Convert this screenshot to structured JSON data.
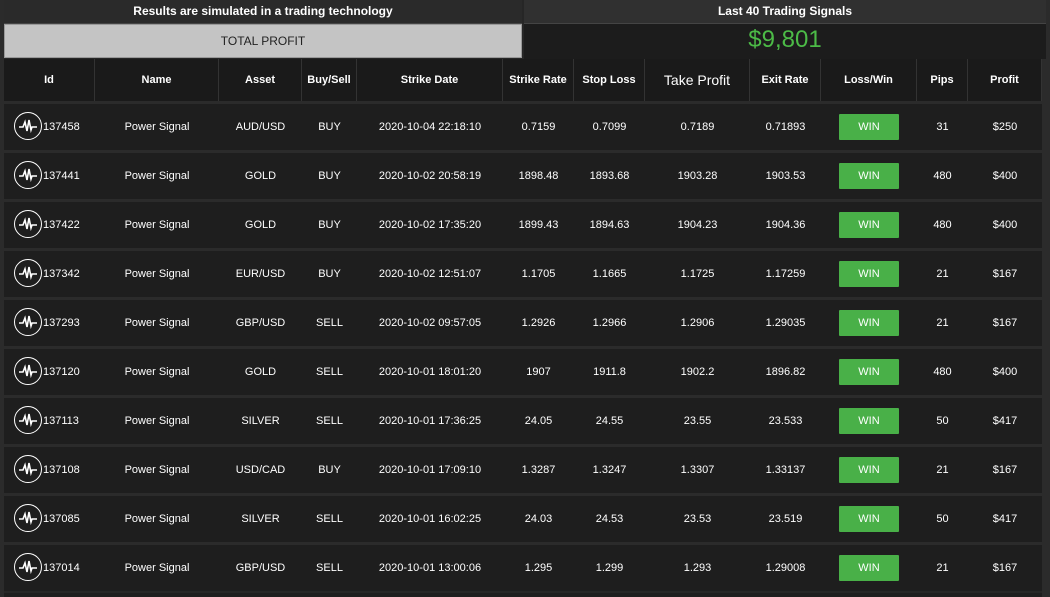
{
  "header": {
    "left_title": "Results are simulated in a trading technology",
    "total_profit_label": "TOTAL PROFIT",
    "right_title": "Last 40 Trading Signals",
    "total_profit_value": "$9,801"
  },
  "columns": [
    "Id",
    "Name",
    "Asset",
    "Buy/Sell",
    "Strike Date",
    "Strike Rate",
    "Stop Loss",
    "Take Profit",
    "Exit Rate",
    "Loss/Win",
    "Pips",
    "Profit"
  ],
  "rows": [
    {
      "id": "137458",
      "name": "Power Signal",
      "asset": "AUD/USD",
      "side": "BUY",
      "date": "2020-10-04 22:18:10",
      "strike": "0.7159",
      "stop": "0.7099",
      "take": "0.7189",
      "exit": "0.71893",
      "result": "WIN",
      "pips": "31",
      "profit": "$250"
    },
    {
      "id": "137441",
      "name": "Power Signal",
      "asset": "GOLD",
      "side": "BUY",
      "date": "2020-10-02 20:58:19",
      "strike": "1898.48",
      "stop": "1893.68",
      "take": "1903.28",
      "exit": "1903.53",
      "result": "WIN",
      "pips": "480",
      "profit": "$400"
    },
    {
      "id": "137422",
      "name": "Power Signal",
      "asset": "GOLD",
      "side": "BUY",
      "date": "2020-10-02 17:35:20",
      "strike": "1899.43",
      "stop": "1894.63",
      "take": "1904.23",
      "exit": "1904.36",
      "result": "WIN",
      "pips": "480",
      "profit": "$400"
    },
    {
      "id": "137342",
      "name": "Power Signal",
      "asset": "EUR/USD",
      "side": "BUY",
      "date": "2020-10-02 12:51:07",
      "strike": "1.1705",
      "stop": "1.1665",
      "take": "1.1725",
      "exit": "1.17259",
      "result": "WIN",
      "pips": "21",
      "profit": "$167"
    },
    {
      "id": "137293",
      "name": "Power Signal",
      "asset": "GBP/USD",
      "side": "SELL",
      "date": "2020-10-02 09:57:05",
      "strike": "1.2926",
      "stop": "1.2966",
      "take": "1.2906",
      "exit": "1.29035",
      "result": "WIN",
      "pips": "21",
      "profit": "$167"
    },
    {
      "id": "137120",
      "name": "Power Signal",
      "asset": "GOLD",
      "side": "SELL",
      "date": "2020-10-01 18:01:20",
      "strike": "1907",
      "stop": "1911.8",
      "take": "1902.2",
      "exit": "1896.82",
      "result": "WIN",
      "pips": "480",
      "profit": "$400"
    },
    {
      "id": "137113",
      "name": "Power Signal",
      "asset": "SILVER",
      "side": "SELL",
      "date": "2020-10-01 17:36:25",
      "strike": "24.05",
      "stop": "24.55",
      "take": "23.55",
      "exit": "23.533",
      "result": "WIN",
      "pips": "50",
      "profit": "$417"
    },
    {
      "id": "137108",
      "name": "Power Signal",
      "asset": "USD/CAD",
      "side": "BUY",
      "date": "2020-10-01 17:09:10",
      "strike": "1.3287",
      "stop": "1.3247",
      "take": "1.3307",
      "exit": "1.33137",
      "result": "WIN",
      "pips": "21",
      "profit": "$167"
    },
    {
      "id": "137085",
      "name": "Power Signal",
      "asset": "SILVER",
      "side": "SELL",
      "date": "2020-10-01 16:02:25",
      "strike": "24.03",
      "stop": "24.53",
      "take": "23.53",
      "exit": "23.519",
      "result": "WIN",
      "pips": "50",
      "profit": "$417"
    },
    {
      "id": "137014",
      "name": "Power Signal",
      "asset": "GBP/USD",
      "side": "SELL",
      "date": "2020-10-01 13:00:06",
      "strike": "1.295",
      "stop": "1.299",
      "take": "1.293",
      "exit": "1.29008",
      "result": "WIN",
      "pips": "21",
      "profit": "$167"
    }
  ],
  "colors": {
    "win": "#49b048",
    "total_profit": "#4cbb47"
  },
  "icons": {
    "row_icon": "pulse-icon"
  }
}
